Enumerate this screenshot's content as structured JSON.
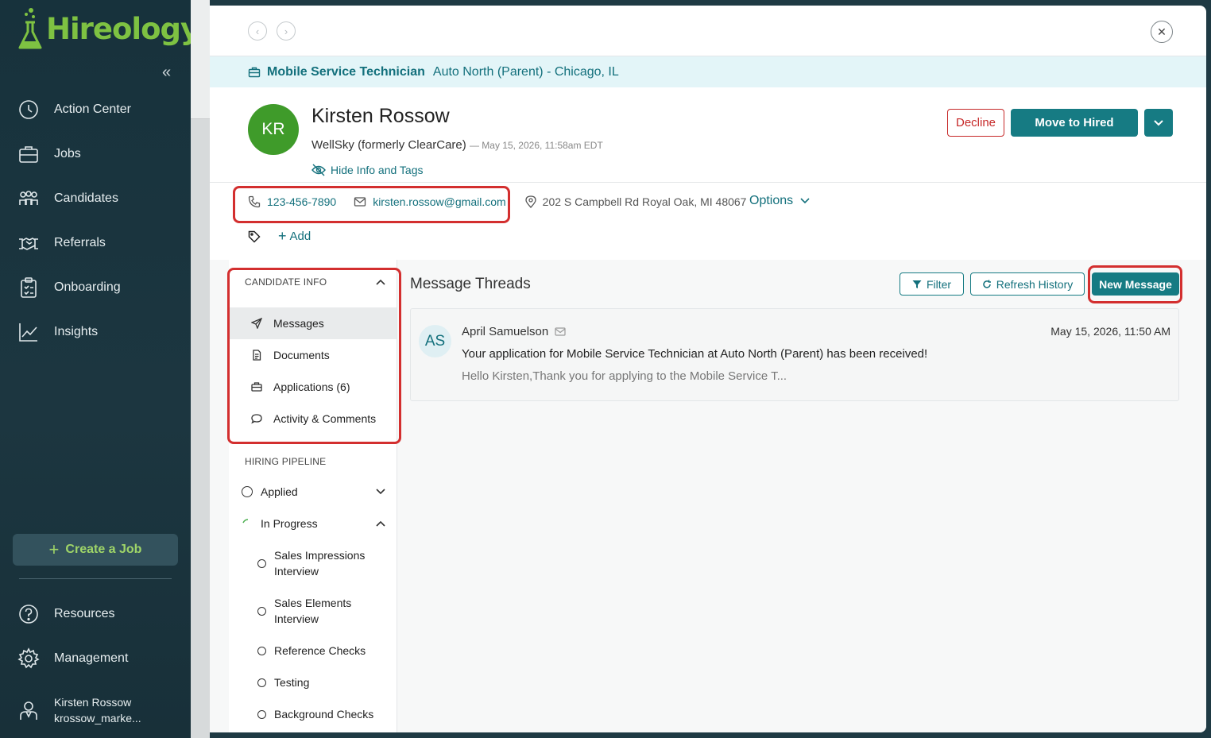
{
  "brand": {
    "name": "Hireology",
    "accent": "#7ec242",
    "teal": "#167b83"
  },
  "sidebar": {
    "collapse_icon": "double-chevron-left-icon",
    "items": [
      {
        "label": "Action Center",
        "icon": "clock-icon"
      },
      {
        "label": "Jobs",
        "icon": "briefcase-icon"
      },
      {
        "label": "Candidates",
        "icon": "people-icon"
      },
      {
        "label": "Referrals",
        "icon": "handshake-icon"
      },
      {
        "label": "Onboarding",
        "icon": "clipboard-icon"
      },
      {
        "label": "Insights",
        "icon": "chart-icon"
      }
    ],
    "create_job": "Create a Job",
    "bottom_items": [
      {
        "label": "Resources",
        "icon": "question-icon"
      },
      {
        "label": "Management",
        "icon": "gear-icon"
      }
    ],
    "user": {
      "name": "Kirsten Rossow",
      "handle": "krossow_marke..."
    }
  },
  "job": {
    "title": "Mobile Service Technician",
    "location": "Auto North (Parent) - Chicago, IL"
  },
  "candidate": {
    "initials": "KR",
    "name": "Kirsten Rossow",
    "company": "WellSky (formerly ClearCare)",
    "applied_date": "— May 15, 2026, 11:58am EDT",
    "hide_info": "Hide Info and Tags",
    "phone": "123-456-7890",
    "email": "kirsten.rossow@gmail.com",
    "address": "202 S Campbell Rd Royal Oak, MI 48067",
    "options": "Options",
    "add_tag": "Add"
  },
  "actions": {
    "decline": "Decline",
    "move": "Move to Hired"
  },
  "candidate_info": {
    "title": "CANDIDATE INFO",
    "items": [
      {
        "label": "Messages",
        "icon": "send-icon"
      },
      {
        "label": "Documents",
        "icon": "document-icon"
      },
      {
        "label": "Applications (6)",
        "icon": "briefcase-icon"
      },
      {
        "label": "Activity & Comments",
        "icon": "comment-icon"
      }
    ]
  },
  "pipeline": {
    "title": "HIRING PIPELINE",
    "applied": "Applied",
    "in_progress": "In Progress",
    "stages": [
      "Sales Impressions Interview",
      "Sales Elements Interview",
      "Reference Checks",
      "Testing",
      "Background Checks"
    ]
  },
  "messages": {
    "title": "Message Threads",
    "filter": "Filter",
    "refresh": "Refresh History",
    "new": "New Message",
    "thread": {
      "initials": "AS",
      "from": "April Samuelson",
      "date": "May 15, 2026, 11:50 AM",
      "subject": "Your application for Mobile Service Technician at Auto North (Parent) has been received!",
      "preview": "Hello Kirsten,Thank you for applying to the Mobile Service T..."
    }
  }
}
